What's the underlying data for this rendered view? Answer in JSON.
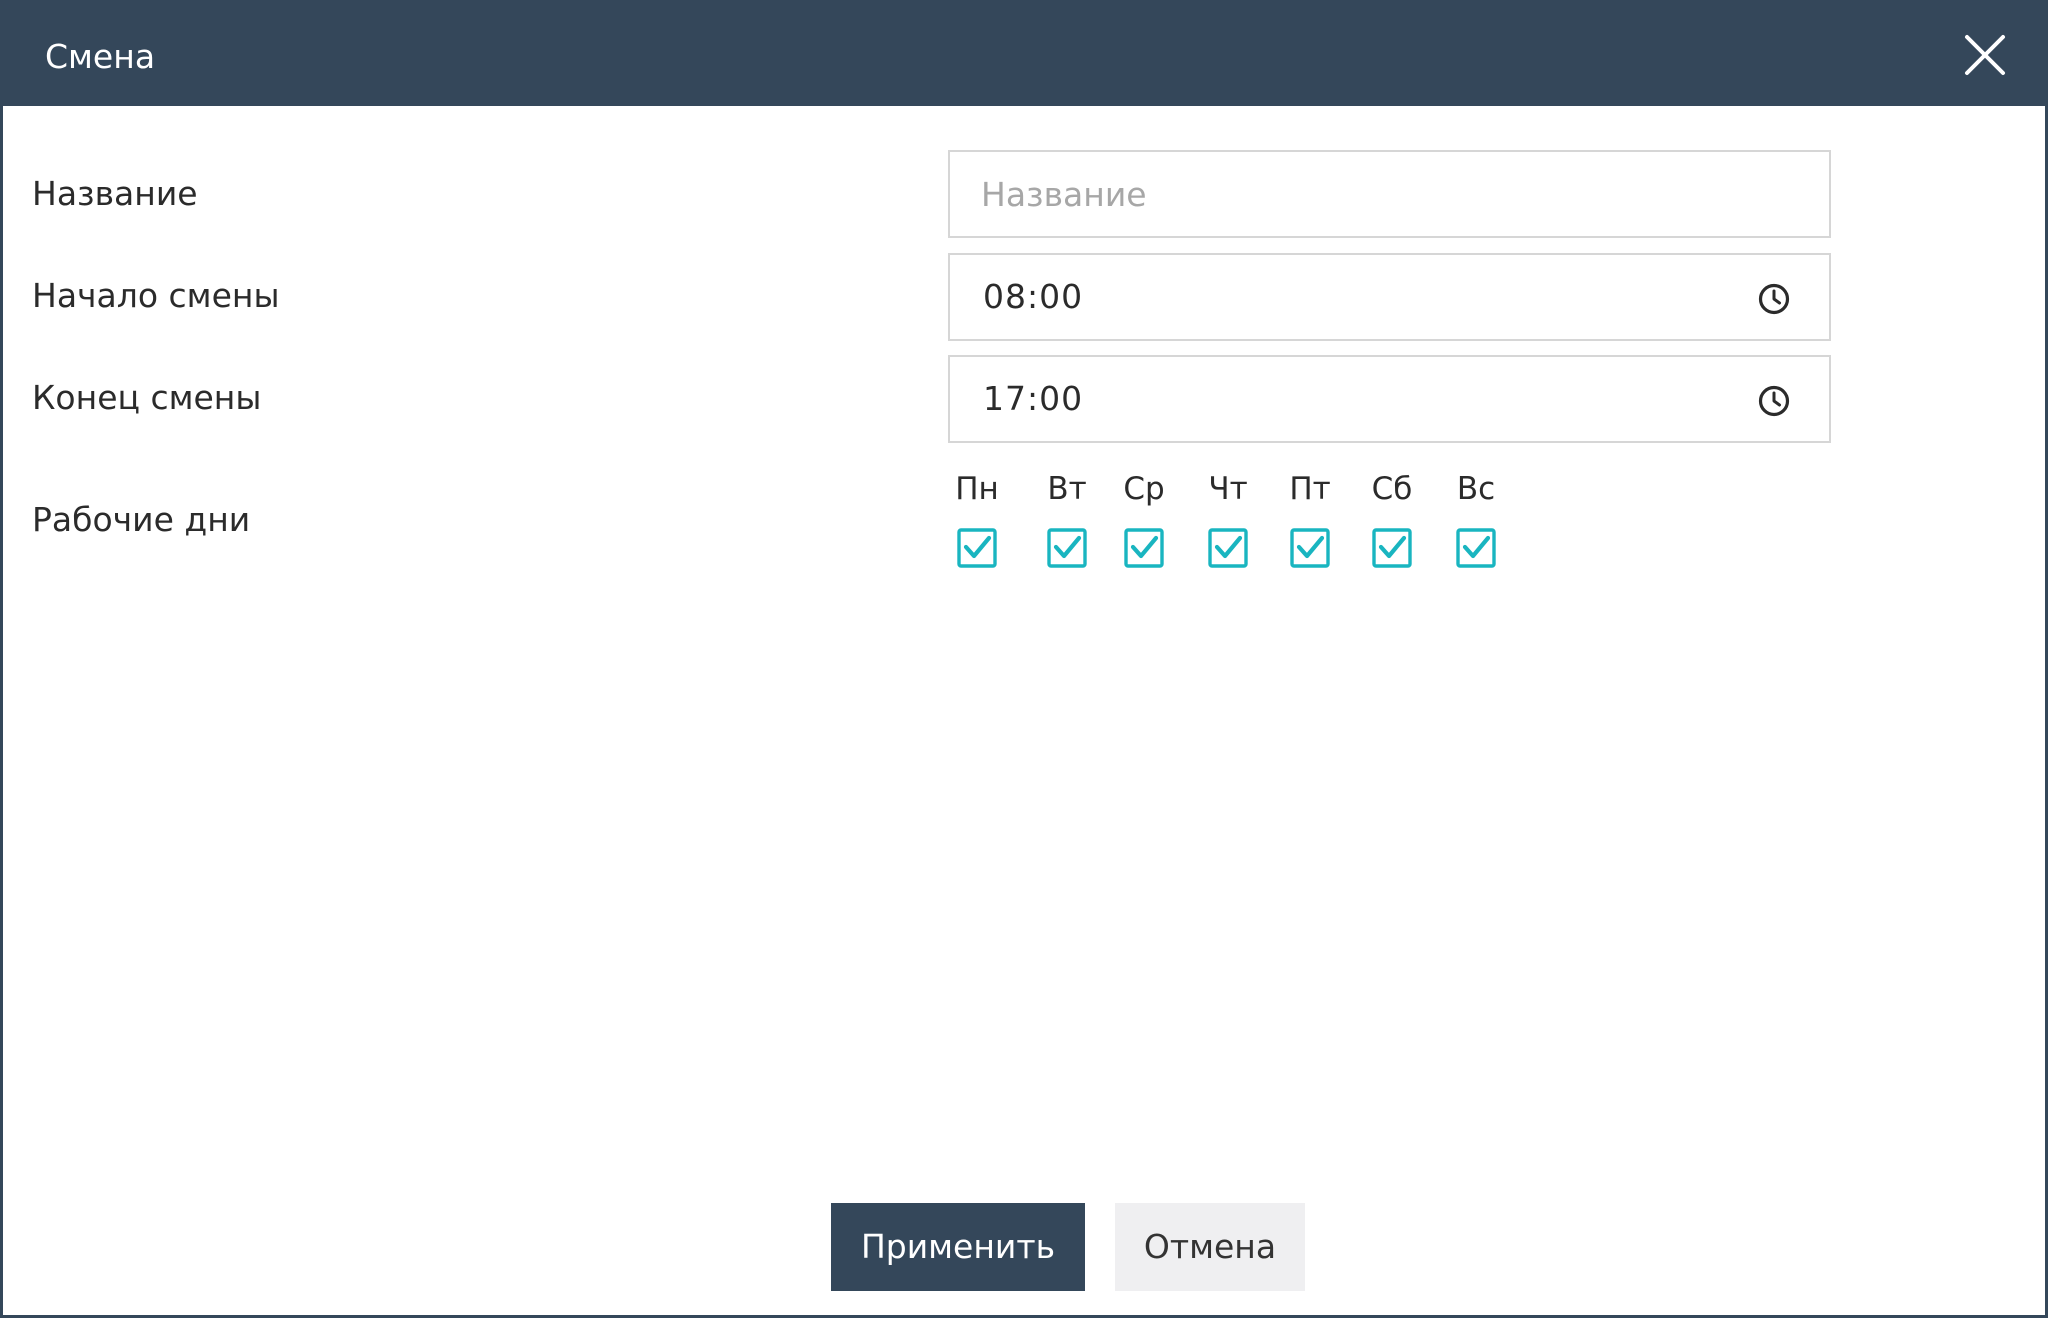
{
  "dialog": {
    "title": "Смена"
  },
  "form": {
    "name": {
      "label": "Название",
      "value": "",
      "placeholder": "Название"
    },
    "start": {
      "label": "Начало смены",
      "value": "08:00"
    },
    "end": {
      "label": "Конец смены",
      "value": "17:00"
    },
    "workdays": {
      "label": "Рабочие дни",
      "days": [
        {
          "label": "Пн",
          "checked": true
        },
        {
          "label": "Вт",
          "checked": true
        },
        {
          "label": "Ср",
          "checked": true
        },
        {
          "label": "Чт",
          "checked": true
        },
        {
          "label": "Пт",
          "checked": true
        },
        {
          "label": "Сб",
          "checked": true
        },
        {
          "label": "Вс",
          "checked": true
        }
      ]
    }
  },
  "buttons": {
    "apply": "Применить",
    "cancel": "Отмена"
  },
  "icons": {
    "close": "close-icon",
    "clock": "clock-icon",
    "checkbox": "checkbox-checked-icon"
  },
  "colors": {
    "header": "#34475a",
    "accent": "#19b5c0",
    "cancel_bg": "#efeff1"
  }
}
